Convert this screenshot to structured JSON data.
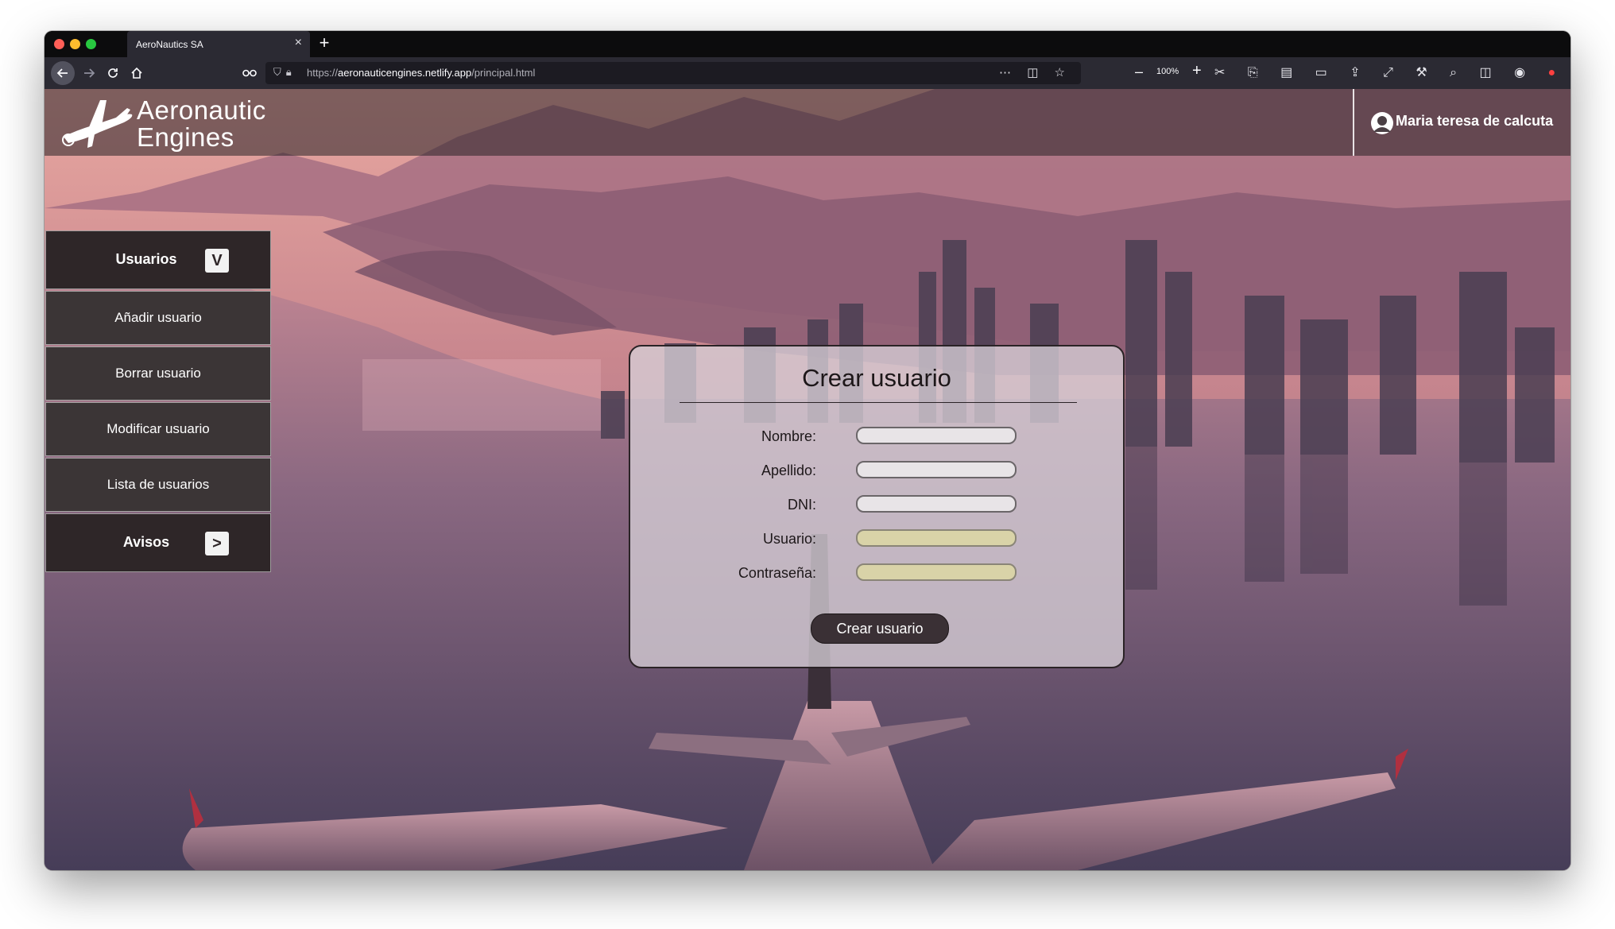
{
  "browser": {
    "tab_title": "AeroNautics SA",
    "tab_close": "×",
    "new_tab": "+",
    "url_prefix": "https://",
    "url_domain": "aeronauticengines.netlify.app",
    "url_path": "/principal.html",
    "zoom_level": "100%",
    "zoom_out": "–",
    "zoom_in": "+"
  },
  "header": {
    "logo_line1": "Aeronautic",
    "logo_line2": "Engines",
    "user_name": "Maria teresa de calcuta"
  },
  "sidebar": {
    "usuarios_label": "Usuarios",
    "usuarios_badge": "V",
    "items": [
      {
        "label": "Añadir usuario"
      },
      {
        "label": "Borrar usuario"
      },
      {
        "label": "Modificar usuario"
      },
      {
        "label": "Lista de usuarios"
      }
    ],
    "avisos_label": "Avisos",
    "avisos_badge": ">"
  },
  "form": {
    "title": "Crear usuario",
    "fields": [
      {
        "label": "Nombre:",
        "value": ""
      },
      {
        "label": "Apellido:",
        "value": ""
      },
      {
        "label": "DNI:",
        "value": ""
      },
      {
        "label": "Usuario:",
        "value": ""
      },
      {
        "label": "Contraseña:",
        "value": ""
      }
    ],
    "submit_label": "Crear usuario"
  },
  "colors": {
    "header_bg": "#282226",
    "sidebar_head": "#2e2628",
    "sidebar_item": "#3b3536",
    "button": "#3a3035",
    "autofill": "#d9d3a8"
  }
}
